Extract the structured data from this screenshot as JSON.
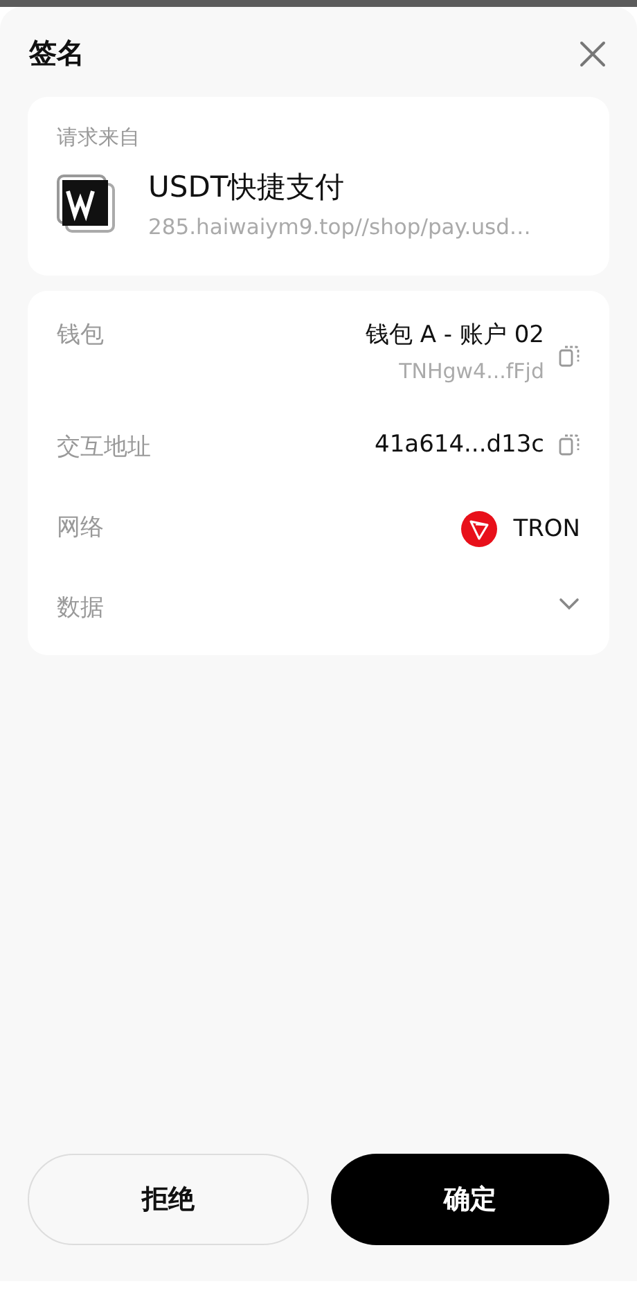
{
  "header": {
    "title": "签名"
  },
  "source": {
    "label": "请求来自",
    "name": "USDT快捷支付",
    "url": "285.haiwaiym9.top//shop/pay.usd…"
  },
  "details": [
    {
      "kind": "wallet",
      "label": "钱包",
      "value": "钱包 A - 账户 02",
      "sub": "TNHgw4...fFjd"
    },
    {
      "kind": "address",
      "label": "交互地址",
      "value": "41a614...d13c"
    },
    {
      "kind": "network",
      "label": "网络",
      "value": "TRON"
    },
    {
      "kind": "expander",
      "label": "数据",
      "expanded": false
    }
  ],
  "buttons": [
    {
      "kind": "secondary",
      "label": "拒绝"
    },
    {
      "kind": "primary",
      "label": "确定"
    }
  ]
}
